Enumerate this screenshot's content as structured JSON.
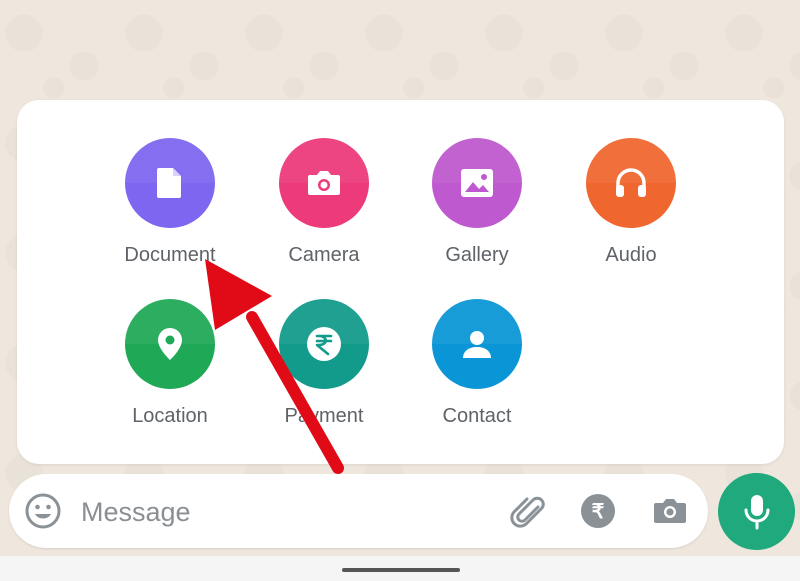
{
  "attach_menu": {
    "items": [
      {
        "label": "Document",
        "color": "#7e66f0",
        "icon": "document-icon"
      },
      {
        "label": "Camera",
        "color": "#ec3a7a",
        "icon": "camera-icon"
      },
      {
        "label": "Gallery",
        "color": "#bf59cf",
        "icon": "gallery-icon"
      },
      {
        "label": "Audio",
        "color": "#f0662f",
        "icon": "headphones-icon"
      },
      {
        "label": "Location",
        "color": "#1fa855",
        "icon": "location-pin-icon"
      },
      {
        "label": "Payment",
        "color": "#129b8a",
        "icon": "rupee-icon"
      },
      {
        "label": "Contact",
        "color": "#0a96d6",
        "icon": "person-icon"
      }
    ]
  },
  "annotation": {
    "color": "#e10b17",
    "points_to": "Document"
  },
  "composer": {
    "placeholder": "Message",
    "rupee_symbol": "₹",
    "mic_color": "#1fa97d"
  }
}
